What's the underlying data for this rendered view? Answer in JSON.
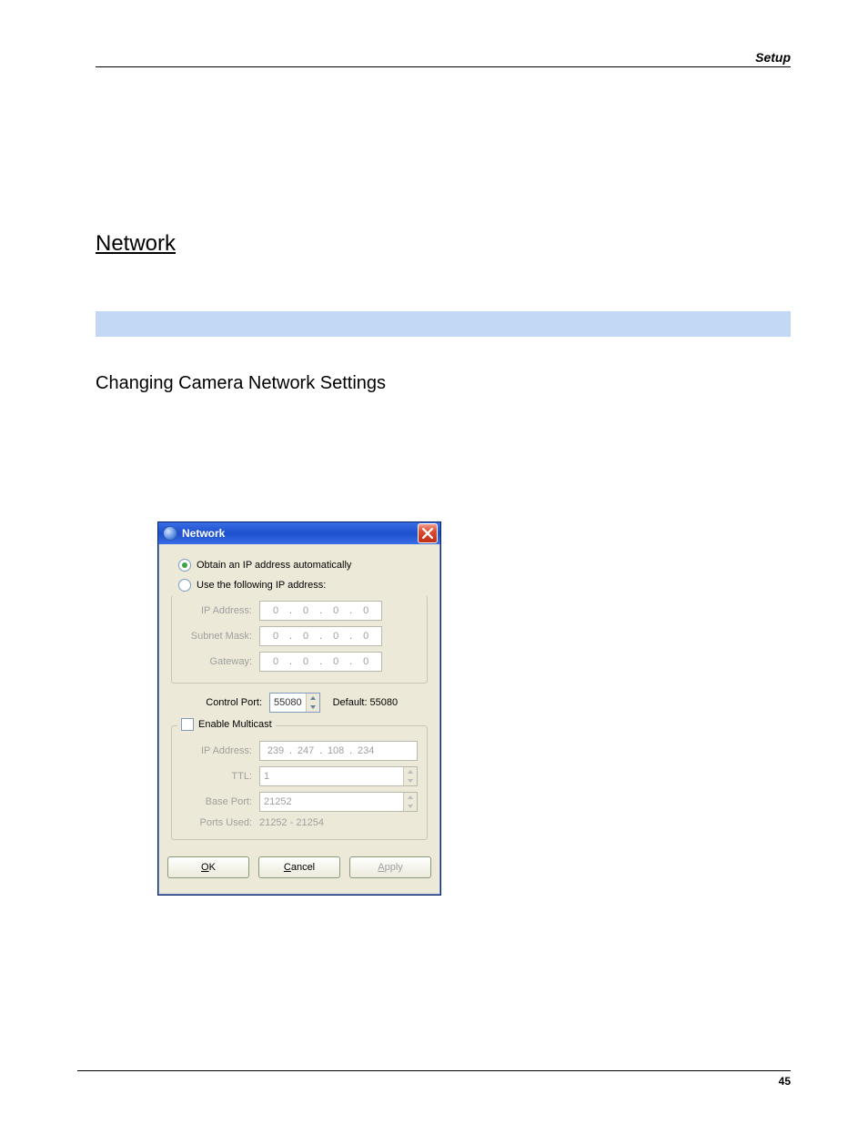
{
  "page": {
    "header_right": "Setup",
    "section_title": "Network",
    "sub_title": "Changing Camera Network Settings",
    "page_number": "45"
  },
  "dialog": {
    "title": "Network",
    "radios": {
      "auto": {
        "label": "Obtain an IP address automatically",
        "selected": true
      },
      "manual": {
        "label": "Use the following IP address:",
        "selected": false
      }
    },
    "ip_fields": {
      "ip_address": {
        "label": "IP Address:",
        "octets": [
          "0",
          "0",
          "0",
          "0"
        ]
      },
      "subnet": {
        "label": "Subnet Mask:",
        "octets": [
          "0",
          "0",
          "0",
          "0"
        ]
      },
      "gateway": {
        "label": "Gateway:",
        "octets": [
          "0",
          "0",
          "0",
          "0"
        ]
      }
    },
    "control_port": {
      "label": "Control Port:",
      "value": "55080",
      "default_label": "Default: 55080"
    },
    "multicast": {
      "legend": "Enable Multicast",
      "checked": false,
      "ip_address": {
        "label": "IP Address:",
        "octets": [
          "239",
          "247",
          "108",
          "234"
        ]
      },
      "ttl": {
        "label": "TTL:",
        "value": "1"
      },
      "base_port": {
        "label": "Base Port:",
        "value": "21252"
      },
      "ports_used": {
        "label": "Ports Used:",
        "value": "21252 - 21254"
      }
    },
    "buttons": {
      "ok_pre": "",
      "ok_m": "O",
      "ok_post": "K",
      "cancel_pre": "",
      "cancel_m": "C",
      "cancel_post": "ancel",
      "apply_pre": "",
      "apply_m": "A",
      "apply_post": "pply"
    }
  }
}
